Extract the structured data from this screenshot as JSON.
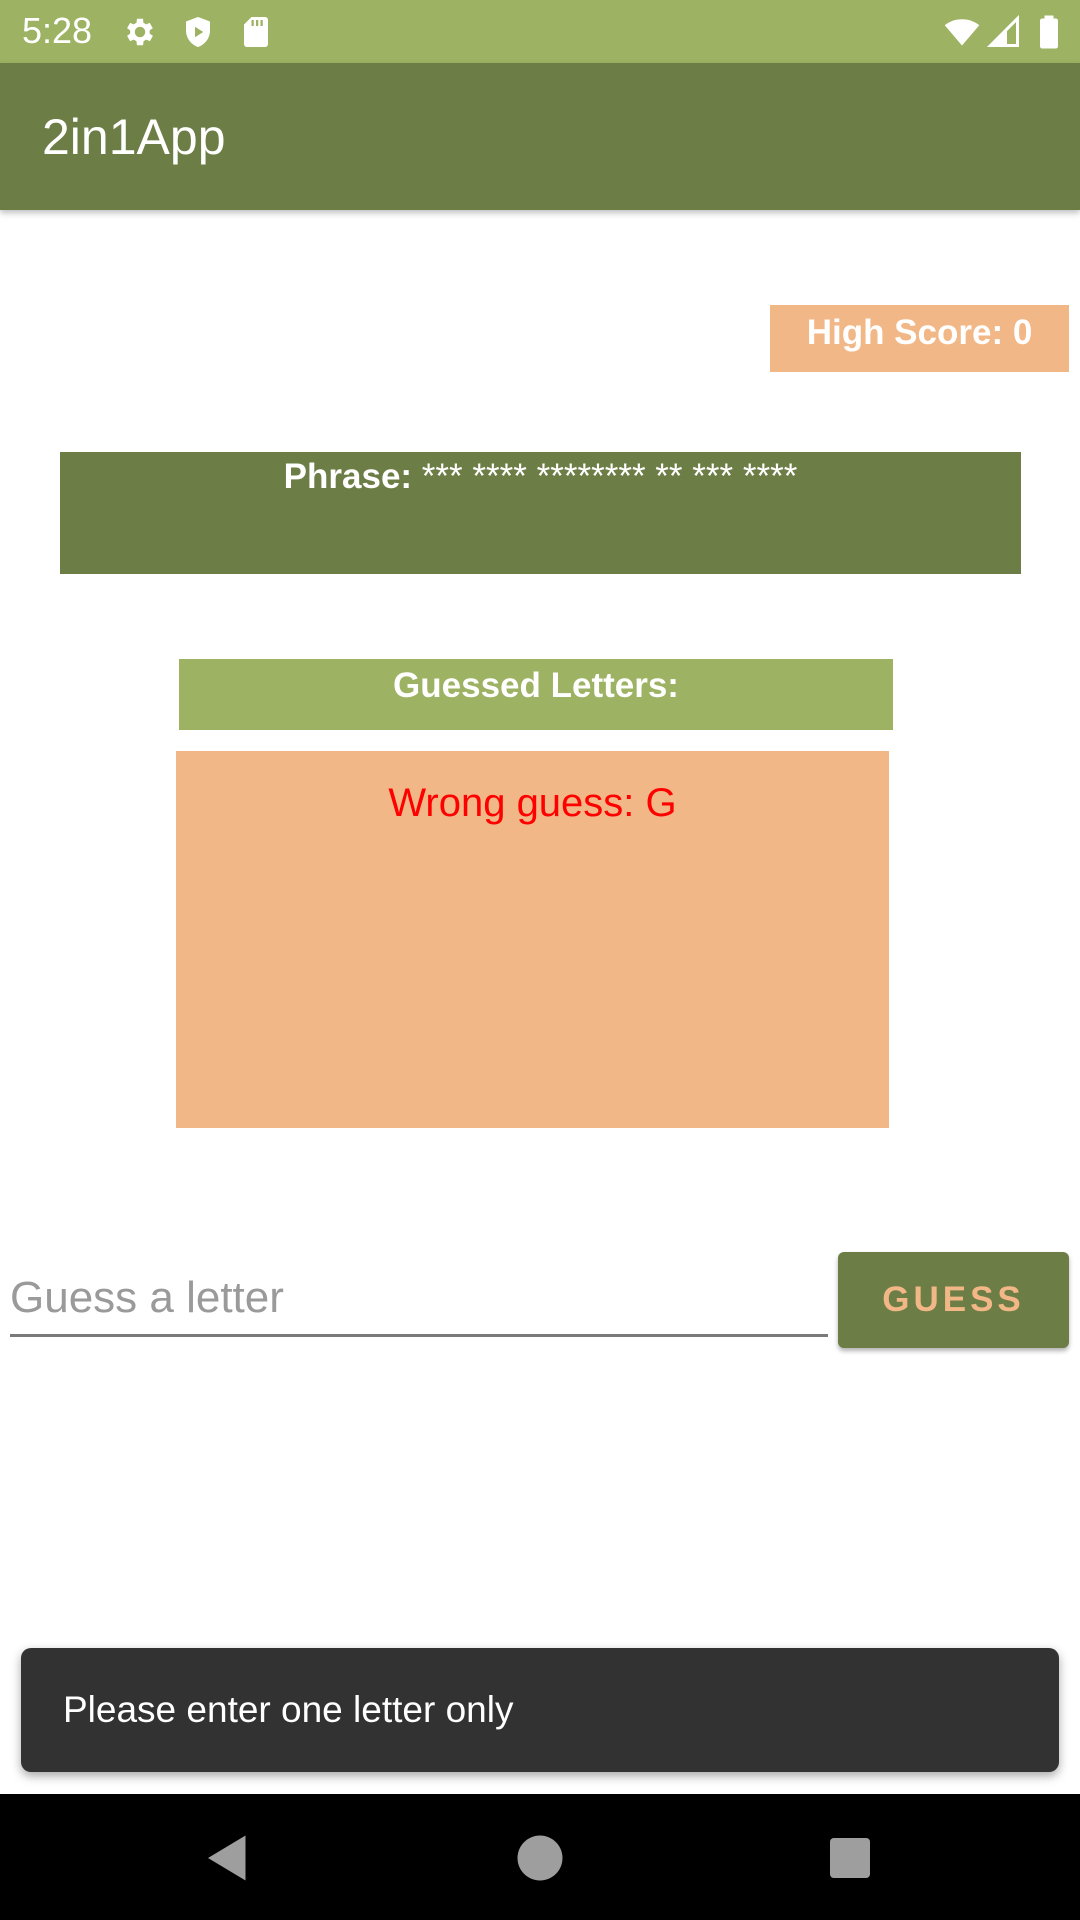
{
  "status_bar": {
    "time": "5:28",
    "left_icons": [
      "gear-icon",
      "shield-icon",
      "sd-card-icon"
    ],
    "right_icons": [
      "wifi-icon",
      "cell-signal-icon",
      "battery-icon"
    ]
  },
  "app_bar": {
    "title": "2in1App"
  },
  "high_score": {
    "text": "High Score: 0"
  },
  "phrase": {
    "label": "Phrase:",
    "value": " *** **** ******** ** *** ****"
  },
  "guessed_letters": {
    "label": "Guessed Letters:"
  },
  "wrong_guess": {
    "text": "Wrong guess: G"
  },
  "guess_input": {
    "value": "",
    "placeholder": "Guess a letter"
  },
  "guess_button": {
    "label": "GUESS"
  },
  "toast": {
    "text": "Please enter one letter only"
  },
  "nav_bar": {
    "icons": [
      "back-icon",
      "home-icon",
      "recents-icon"
    ]
  },
  "colors": {
    "status_bar": "#9db363",
    "app_bar": "#6d7d46",
    "accent_peach": "#f2b786",
    "wrong_text": "#ff0000",
    "toast_bg": "#323232"
  }
}
